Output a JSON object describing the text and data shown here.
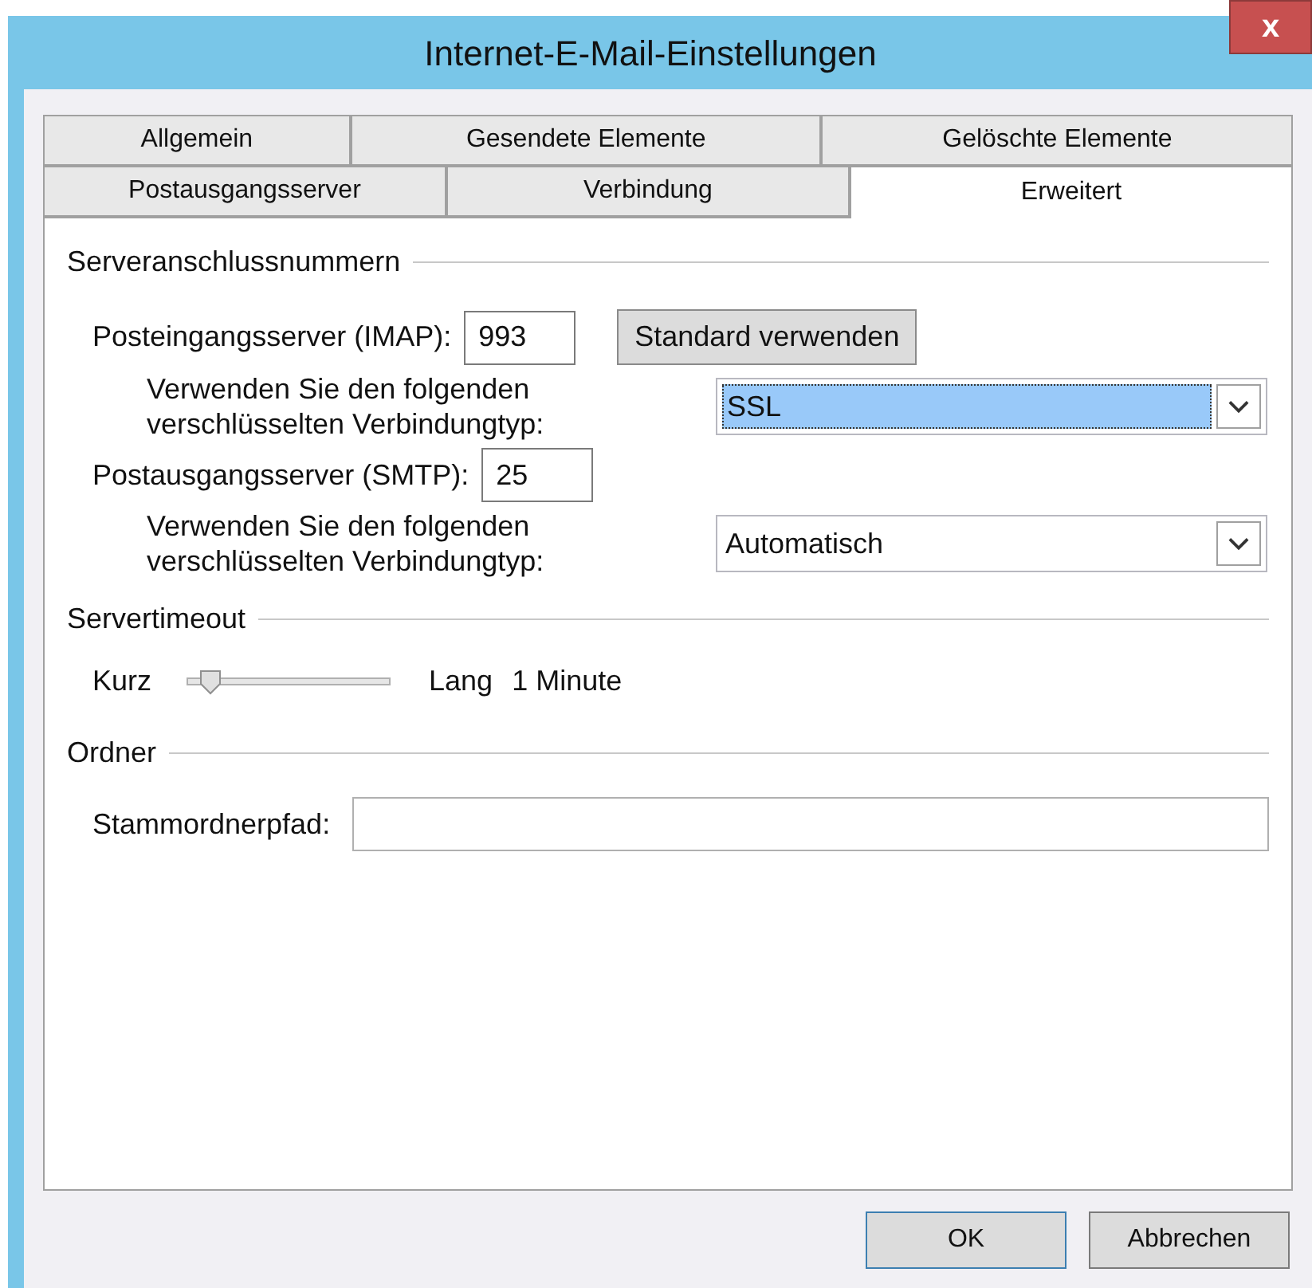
{
  "window": {
    "title": "Internet-E-Mail-Einstellungen",
    "close": "x"
  },
  "tab_rows": [
    [
      {
        "label": "Allgemein",
        "selected": false
      },
      {
        "label": "Gesendete Elemente",
        "selected": false
      },
      {
        "label": "Gelöschte Elemente",
        "selected": false
      }
    ],
    [
      {
        "label": "Postausgangsserver",
        "selected": false
      },
      {
        "label": "Verbindung",
        "selected": false
      },
      {
        "label": "Erweitert",
        "selected": true
      }
    ]
  ],
  "server_ports": {
    "title": "Serveranschlussnummern",
    "incoming": {
      "label": "Posteingangsserver (IMAP):",
      "value": "993",
      "button": "Standard verwenden",
      "encryption_label": "Verwenden Sie den folgenden verschlüsselten Verbindungtyp:",
      "encryption": "SSL",
      "focused": true
    },
    "outgoing": {
      "label": "Postausgangsserver (SMTP):",
      "value": "25",
      "encryption_label": "Verwenden Sie den folgenden verschlüsselten Verbindungtyp:",
      "encryption": "Automatisch",
      "focused": false
    }
  },
  "server_timeout": {
    "title": "Servertimeout",
    "min_label": "Kurz",
    "max_label": "Lang",
    "level": 0.06,
    "reading": "1 Minute"
  },
  "folders": {
    "title": "Ordner",
    "root_label": "Stammordnerpfad:"
  },
  "buttons": [
    {
      "label": "OK",
      "default": true
    },
    {
      "label": "Abbrechen",
      "default": false
    }
  ]
}
